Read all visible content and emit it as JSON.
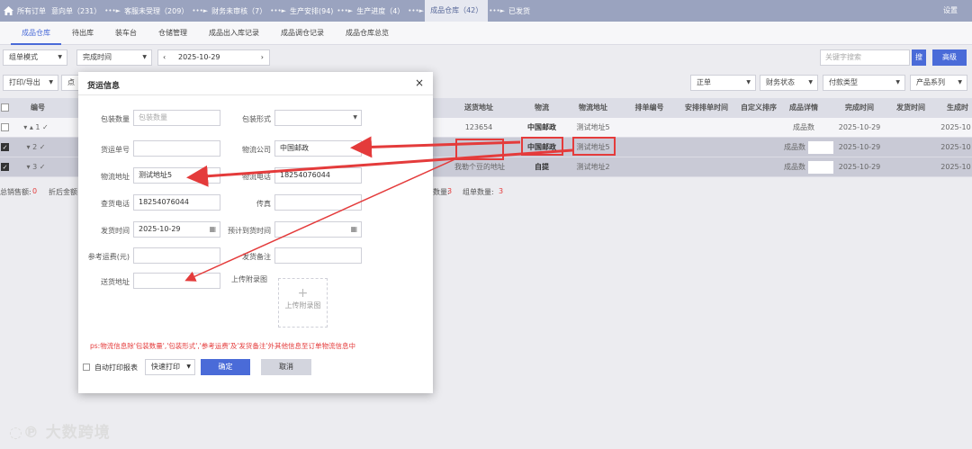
{
  "topbar": {
    "steps": [
      "所有订单",
      "意向单（231）",
      "客服未受理（209）",
      "财务未审核（7）",
      "生产安排(94)",
      "生产进度（4）",
      "成品仓库（42）",
      "已发货"
    ],
    "settings": "设置"
  },
  "subtabs": [
    "成品仓库",
    "待出库",
    "装车台",
    "仓储管理",
    "成品出入库记录",
    "成品调仓记录",
    "成品仓库总览"
  ],
  "filters": {
    "mode": "组单模式",
    "time_type": "完成时间",
    "date": "2025-10-29",
    "keyword_placeholder": "关键字搜索",
    "search_btn": "搜",
    "advanced_btn": "高级",
    "print_export": "打印/导出",
    "order_type": "正单",
    "finance_status": "财务状态",
    "pay_type": "付款类型",
    "product_series": "产品系列"
  },
  "table": {
    "headers": [
      "编号",
      "送货地址",
      "物流",
      "物流地址",
      "排单编号",
      "安排排单时间",
      "自定义排序",
      "成品详情",
      "完成时间",
      "发货时间",
      "生成时"
    ],
    "rows": [
      {
        "num": "1",
        "address": "123654",
        "logistics": "中国邮政",
        "logistics_addr": "测试地址5",
        "detail": "成品数",
        "done_time": "2025-10-29",
        "gen": "2025-10"
      },
      {
        "num": "2",
        "address": "",
        "logistics": "中国邮政",
        "logistics_addr": "测试地址5",
        "detail": "成品数",
        "done_time": "2025-10-29",
        "gen": "2025-10"
      },
      {
        "num": "3",
        "address": "我勒个豆的地址",
        "logistics": "自提",
        "logistics_addr": "测试地址2",
        "detail": "成品数",
        "done_time": "2025-10-29",
        "gen": "2025-10"
      }
    ]
  },
  "summary": {
    "sales_label": "总销售额:",
    "sales_value": "0",
    "discount_label": "折后金额",
    "qty_suffix": "数量:",
    "qty_value": "3",
    "group_label": "组单数量:",
    "group_value": "3"
  },
  "modal": {
    "title": "货运信息",
    "fields": {
      "pack_qty_label": "包装数量",
      "pack_qty_placeholder": "包装数量",
      "pack_form_label": "包装形式",
      "waybill_label": "货运单号",
      "company_label": "物流公司",
      "company_value": "中国邮政",
      "logi_addr_label": "物流地址",
      "logi_addr_value": "测试地址5",
      "logi_phone_label": "物流电话",
      "logi_phone_value": "18254076044",
      "check_phone_label": "查货电话",
      "check_phone_value": "18254076044",
      "fax_label": "传真",
      "ship_time_label": "发货时间",
      "ship_time_value": "2025-10-29",
      "eta_label": "预计到货时间",
      "ref_fee_label": "参考运费(元)",
      "ship_note_label": "发货备注",
      "delivery_addr_label": "送货地址",
      "upload_label": "上传附录图",
      "upload_text": "上传附录图"
    },
    "note": "ps:物流信息除'包装数量','包装形式','参考运费'及'发货备注'外其他信息至订单物流信息中",
    "auto_print_label": "自动打印报表",
    "print_option": "快速打印",
    "ok": "确定",
    "cancel": "取消"
  },
  "watermark": "大数跨境",
  "colors": {
    "accent": "#4a6bd8",
    "annotation": "#e43b3b",
    "topbar": "#9aa3bf"
  }
}
